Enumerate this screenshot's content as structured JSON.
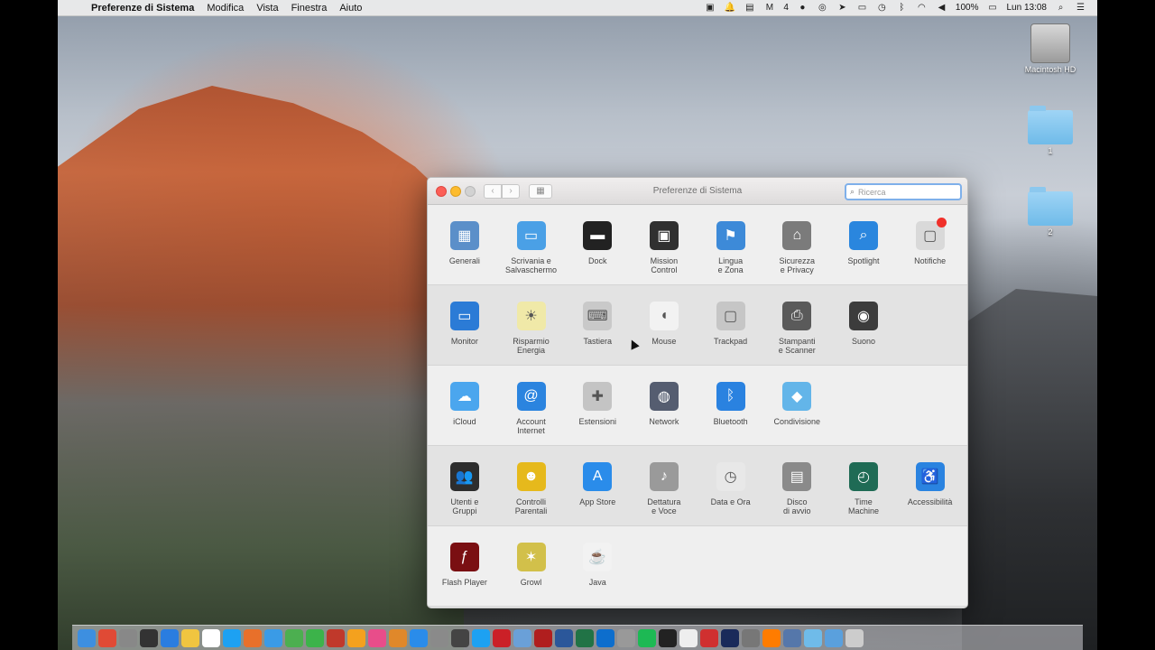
{
  "menubar": {
    "app": "Preferenze di Sistema",
    "items": [
      "Modifica",
      "Vista",
      "Finestra",
      "Aiuto"
    ],
    "status": {
      "spaces": "4",
      "battery": "100%",
      "clock": "Lun 13:08"
    }
  },
  "desktop": {
    "icons": [
      {
        "label": "Macintosh HD",
        "icon": "hard-drive-icon"
      },
      {
        "label": "1",
        "icon": "folder-icon"
      },
      {
        "label": "2",
        "icon": "folder-icon"
      }
    ]
  },
  "window": {
    "title": "Preferenze di Sistema",
    "search_placeholder": "Ricerca",
    "rows": [
      [
        {
          "label": "Generali",
          "icon": "general-icon",
          "color": "#5b8fc9"
        },
        {
          "label": "Scrivania e\nSalvaschermo",
          "icon": "desktop-icon",
          "color": "#4aa0e6"
        },
        {
          "label": "Dock",
          "icon": "dock-icon",
          "color": "#222222"
        },
        {
          "label": "Mission\nControl",
          "icon": "mission-control-icon",
          "color": "#303030"
        },
        {
          "label": "Lingua\ne Zona",
          "icon": "flag-icon",
          "color": "#3d8ad8"
        },
        {
          "label": "Sicurezza\ne Privacy",
          "icon": "house-lock-icon",
          "color": "#7b7b7b"
        },
        {
          "label": "Spotlight",
          "icon": "spotlight-icon",
          "color": "#2a86de"
        },
        {
          "label": "Notifiche",
          "icon": "notifications-icon",
          "color": "#d9d9d9"
        }
      ],
      [
        {
          "label": "Monitor",
          "icon": "monitor-icon",
          "color": "#2b7bd6"
        },
        {
          "label": "Risparmio\nEnergia",
          "icon": "bulb-icon",
          "color": "#f0e9a8"
        },
        {
          "label": "Tastiera",
          "icon": "keyboard-icon",
          "color": "#c9c9c9"
        },
        {
          "label": "Mouse",
          "icon": "mouse-icon",
          "color": "#f2f2f2"
        },
        {
          "label": "Trackpad",
          "icon": "trackpad-icon",
          "color": "#c6c6c6"
        },
        {
          "label": "Stampanti\ne Scanner",
          "icon": "printer-icon",
          "color": "#5a5a5a"
        },
        {
          "label": "Suono",
          "icon": "speaker-icon",
          "color": "#3c3c3c"
        }
      ],
      [
        {
          "label": "iCloud",
          "icon": "icloud-icon",
          "color": "#4ba6ee"
        },
        {
          "label": "Account\nInternet",
          "icon": "at-icon",
          "color": "#2b84df"
        },
        {
          "label": "Estensioni",
          "icon": "puzzle-icon",
          "color": "#c4c4c4"
        },
        {
          "label": "Network",
          "icon": "globe-icon",
          "color": "#555d70"
        },
        {
          "label": "Bluetooth",
          "icon": "bluetooth-icon",
          "color": "#2a82e0"
        },
        {
          "label": "Condivisione",
          "icon": "sharing-folder-icon",
          "color": "#63b5e9"
        }
      ],
      [
        {
          "label": "Utenti e\nGruppi",
          "icon": "users-icon",
          "color": "#2d2d2d"
        },
        {
          "label": "Controlli\nParentali",
          "icon": "parental-icon",
          "color": "#e6b91c"
        },
        {
          "label": "App Store",
          "icon": "app-store-icon",
          "color": "#2a8cea"
        },
        {
          "label": "Dettatura\ne Voce",
          "icon": "microphone-icon",
          "color": "#9a9a9a"
        },
        {
          "label": "Data e Ora",
          "icon": "clock-icon",
          "color": "#e8e8e8"
        },
        {
          "label": "Disco\ndi avvio",
          "icon": "startup-disk-icon",
          "color": "#8a8a8a"
        },
        {
          "label": "Time\nMachine",
          "icon": "time-machine-icon",
          "color": "#1f6b55"
        },
        {
          "label": "Accessibilità",
          "icon": "accessibility-icon",
          "color": "#2a83e0"
        }
      ],
      [
        {
          "label": "Flash Player",
          "icon": "flash-icon",
          "color": "#7a0f12"
        },
        {
          "label": "Growl",
          "icon": "growl-icon",
          "color": "#d2c04a"
        },
        {
          "label": "Java",
          "icon": "java-icon",
          "color": "#f2f2f2"
        }
      ]
    ]
  },
  "dock": {
    "apps": [
      "finder-icon",
      "chrome-icon",
      "launchpad-icon",
      "dashboard-icon",
      "safari-icon",
      "notes-icon",
      "calendar-icon",
      "skype-icon",
      "firefox-icon",
      "safari-icon",
      "messages-icon",
      "facetime-icon",
      "photobooth-icon",
      "photos-icon",
      "itunes-icon",
      "ibooks-icon",
      "app-store-icon",
      "preferences-icon",
      "screen-icon",
      "twitter-icon",
      "pinterest-icon",
      "preview-icon",
      "filezilla-icon",
      "word-icon",
      "excel-icon",
      "dropbox-icon",
      "keychain-icon",
      "spotify-icon",
      "terminal-icon",
      "textedit-icon",
      "pdf-icon",
      "photoshop-icon",
      "camera-icon",
      "illustrator-icon",
      "scanner-icon",
      "folder-icon",
      "downloads-icon",
      "trash-icon"
    ]
  }
}
